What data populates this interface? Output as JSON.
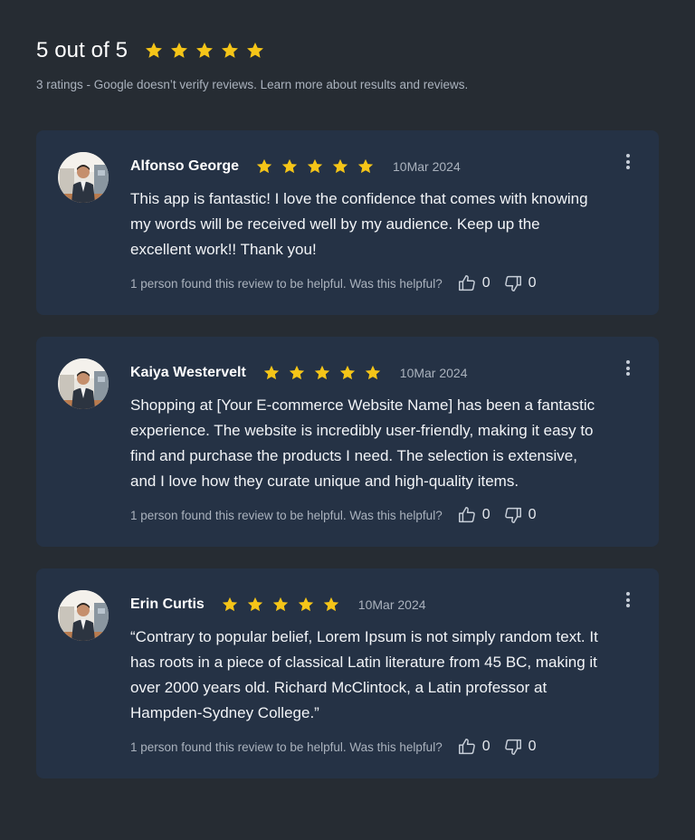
{
  "summary": {
    "title": "5 out of 5",
    "rating": 5,
    "subtitle": "3 ratings - Google doesn’t verify reviews. Learn more about results and reviews."
  },
  "colors": {
    "background": "#262c33",
    "card": "#253245",
    "star": "#f5c518"
  },
  "reviews": [
    {
      "name": "Alfonso George",
      "rating": 5,
      "date": "10Mar 2024",
      "text": "This app is fantastic! I love the confidence that comes with knowing my words will be received well by my audience. Keep up the excellent work!! Thank you!",
      "helpful_text": "1 person found this review to be helpful. Was this helpful?",
      "likes": "0",
      "dislikes": "0"
    },
    {
      "name": "Kaiya Westervelt",
      "rating": 5,
      "date": "10Mar 2024",
      "text": "Shopping at [Your E-commerce Website Name] has been a fantastic experience. The website is incredibly user-friendly, making it easy to find and purchase the products I need. The selection is extensive, and I love how they curate unique and high-quality items.",
      "helpful_text": "1 person found this review to be helpful. Was this helpful?",
      "likes": "0",
      "dislikes": "0"
    },
    {
      "name": "Erin Curtis",
      "rating": 5,
      "date": "10Mar 2024",
      "text": "“Contrary to popular belief, Lorem Ipsum is not simply random text. It has roots in a piece of classical Latin literature from 45 BC, making it over 2000 years old. Richard McClintock, a Latin professor at Hampden-Sydney College.”",
      "helpful_text": "1 person found this review to be helpful. Was this helpful?",
      "likes": "0",
      "dislikes": "0"
    }
  ]
}
